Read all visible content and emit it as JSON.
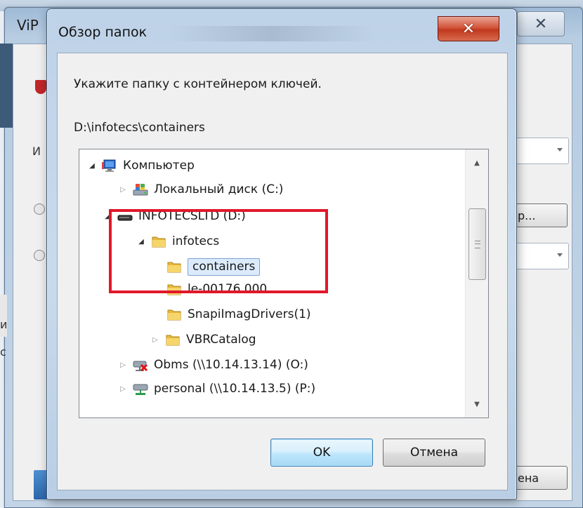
{
  "background_window": {
    "title_fragment": "ViP",
    "close_symbol": "✕",
    "label_fragment_i": "И",
    "button_fragment": "р...",
    "cancel_fragment": "ена",
    "edge_fragment_1": "и",
    "edge_fragment_2": "с"
  },
  "dialog": {
    "title": "Обзор папок",
    "close_symbol": "✕",
    "instruction": "Укажите папку с контейнером ключей.",
    "selected_path": "D:\\infotecs\\containers",
    "tree": {
      "items": [
        {
          "label": "Компьютер",
          "icon": "computer-icon",
          "expander": "expanded"
        },
        {
          "label": "Локальный диск (C:)",
          "icon": "local-disk-icon",
          "expander": "collapsed"
        },
        {
          "label": "INFOTECSLTD (D:)",
          "icon": "usb-drive-icon",
          "expander": "expanded"
        },
        {
          "label": "infotecs",
          "icon": "folder-icon",
          "expander": "expanded"
        },
        {
          "label": "containers",
          "icon": "folder-icon",
          "expander": "none",
          "selected": true
        },
        {
          "label": "le-00176.000",
          "icon": "folder-icon",
          "expander": "none"
        },
        {
          "label": "SnapiImagDrivers(1)",
          "icon": "folder-icon",
          "expander": "none"
        },
        {
          "label": "VBRCatalog",
          "icon": "folder-icon",
          "expander": "collapsed"
        },
        {
          "label": "Obms (\\\\10.14.13.14) (O:)",
          "icon": "disconnected-network-drive-icon",
          "expander": "collapsed"
        },
        {
          "label": "personal (\\\\10.14.13.5) (P:)",
          "icon": "network-drive-icon",
          "expander": "collapsed"
        }
      ]
    },
    "buttons": {
      "ok": "OK",
      "cancel": "Отмена"
    }
  },
  "colors": {
    "highlight": "#e0182a",
    "selection": "#dcebfc",
    "close_button": "#c0391f"
  }
}
